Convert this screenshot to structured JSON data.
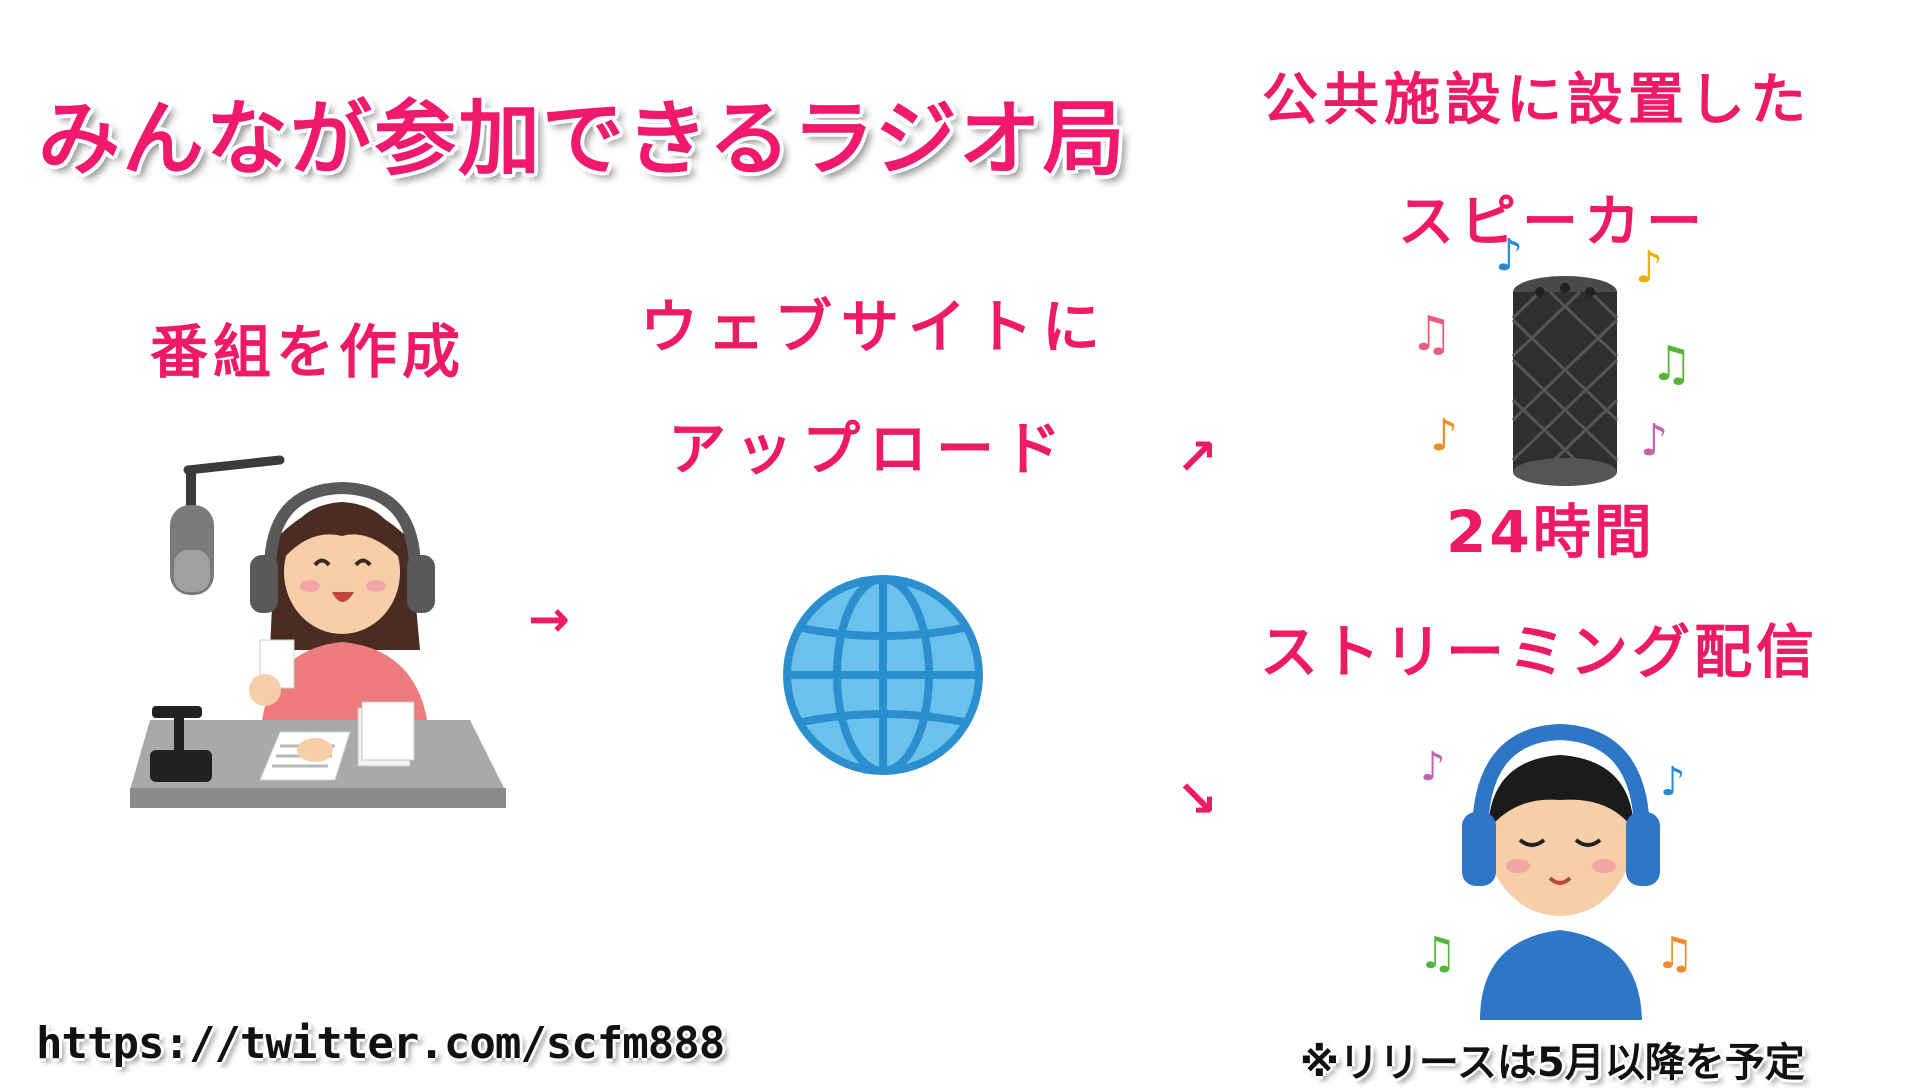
{
  "title": "みんなが参加できるラジオ局",
  "steps": {
    "create": "番組を作成",
    "upload_line1": "ウェブサイトに",
    "upload_line2": "アップロード",
    "speaker_line1": "公共施設に設置した",
    "speaker_line2": "スピーカー",
    "hours": "24時間",
    "streaming": "ストリーミング配信"
  },
  "arrows": {
    "to_upload": "→",
    "to_speaker": "↗",
    "to_streaming": "↘"
  },
  "footer": {
    "url": "https://twitter.com/scfm888",
    "note": "※リリースは5月以降を予定"
  },
  "colors": {
    "accent": "#ef1a66",
    "globe": "#3aa0dc",
    "speaker": "#3a3a3a"
  },
  "icons": [
    "dj-illustration",
    "globe-icon",
    "smart-speaker-icon",
    "headphone-listener-illustration",
    "music-note-icon"
  ]
}
